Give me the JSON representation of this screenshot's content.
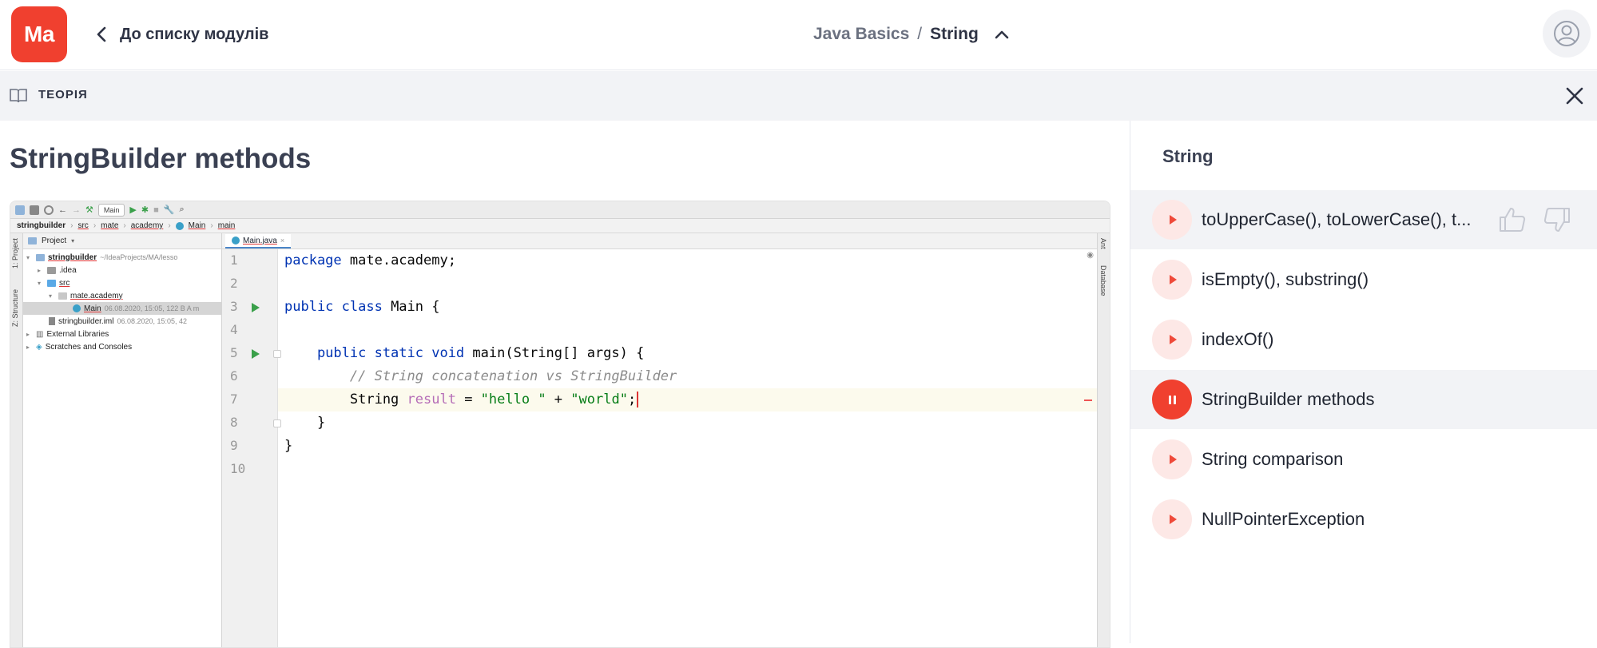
{
  "header": {
    "logo": "Ma",
    "back_label": "До списку модулів",
    "breadcrumb_course": "Java Basics",
    "breadcrumb_sep": "/",
    "breadcrumb_topic": "String"
  },
  "theory_bar": {
    "label": "ТЕОРІЯ"
  },
  "main": {
    "title": "StringBuilder methods"
  },
  "ide": {
    "run_config": "Main",
    "nav": [
      "stringbuilder",
      "src",
      "mate",
      "academy",
      "Main",
      "main"
    ],
    "project_header": "Project",
    "tree": [
      {
        "name": "stringbuilder",
        "meta": "~/IdeaProjects/MA/lesso"
      },
      {
        "name": ".idea",
        "meta": ""
      },
      {
        "name": "src",
        "meta": ""
      },
      {
        "name": "mate.academy",
        "meta": ""
      },
      {
        "name": "Main",
        "meta": "06.08.2020, 15:05, 122 B A m"
      },
      {
        "name": "stringbuilder.iml",
        "meta": "06.08.2020, 15:05, 42"
      },
      {
        "name": "External Libraries",
        "meta": ""
      },
      {
        "name": "Scratches and Consoles",
        "meta": ""
      }
    ],
    "side_tabs_left": [
      "1: Project",
      "Z: Structure"
    ],
    "side_tabs_right": [
      "Ant",
      "Database"
    ],
    "tab": "Main.java",
    "line_numbers": [
      "1",
      "2",
      "3",
      "4",
      "5",
      "6",
      "7",
      "8",
      "9",
      "10"
    ],
    "code": {
      "l1_kw": "package",
      "l1_rest": " mate.academy;",
      "l3_kw": "public class",
      "l3_rest": " Main {",
      "l5_kw": "    public static void",
      "l5_rest": " main(String[] args) {",
      "l6": "        // String concatenation vs StringBuilder",
      "l7_type": "        String ",
      "l7_var": "result",
      "l7_eq": " = ",
      "l7_s1": "\"hello \"",
      "l7_plus": " + ",
      "l7_s2": "\"world\"",
      "l7_end": ";",
      "l8": "    }",
      "l9": "}"
    }
  },
  "sidebar": {
    "title": "String",
    "lessons": [
      {
        "label": "toUpperCase(), toLowerCase(), t..."
      },
      {
        "label": "isEmpty(), substring()"
      },
      {
        "label": "indexOf()"
      },
      {
        "label": "StringBuilder methods"
      },
      {
        "label": "String comparison"
      },
      {
        "label": "NullPointerException"
      }
    ]
  },
  "colors": {
    "brand": "#f0402f",
    "play_bg": "#fde8e6",
    "active_row": "#f2f3f6"
  }
}
